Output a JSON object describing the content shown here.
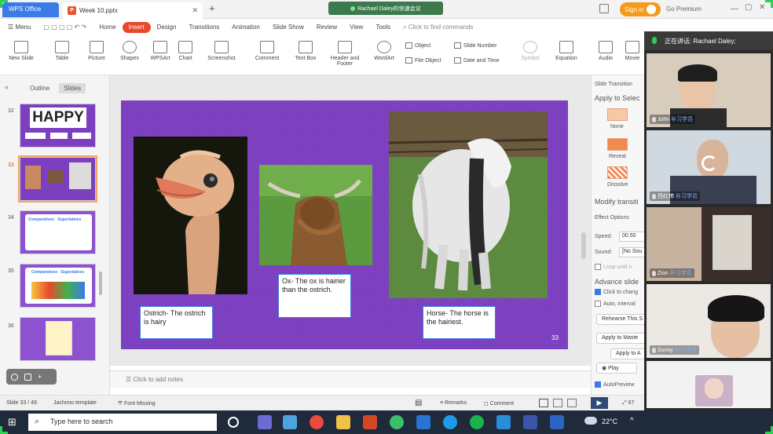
{
  "titlebar": {
    "app_tab": "WPS Office",
    "doc_tab": "Week 10.pptx",
    "meeting_label": "Rachael Daley的快速会议",
    "signin": "Sign in",
    "premium": "Go Premium"
  },
  "menu": {
    "menu_label": "Menu",
    "items": [
      "Home",
      "Insert",
      "Design",
      "Transitions",
      "Animation",
      "Slide Show",
      "Review",
      "View",
      "Tools"
    ],
    "active": "Insert",
    "search_placeholder": "Click to find commands"
  },
  "ribbon": {
    "big": [
      "New Slide",
      "Table",
      "Picture",
      "Shapes",
      "WPSArt",
      "Chart",
      "Screenshot",
      "Comment",
      "Text Box",
      "Header and Footer",
      "WordArt",
      "Symbol",
      "Equation",
      "Audio",
      "Movie"
    ],
    "small": [
      "Object",
      "File Object",
      "Slide Number",
      "Date and Time"
    ]
  },
  "left_panel": {
    "tabs": [
      "Outline",
      "Slides"
    ],
    "active_tab": "Slides",
    "slides": [
      {
        "num": "32",
        "title": "HAPPY"
      },
      {
        "num": "33",
        "title": ""
      },
      {
        "num": "34",
        "title": "Comparatives · Superlatives"
      },
      {
        "num": "35",
        "title": "Comparatives · Superlatives"
      },
      {
        "num": "36",
        "title": ""
      }
    ]
  },
  "slide": {
    "captions": [
      "Ostrich- The ostrich is hairy",
      "Ox- The ox is hairier than the ostrich.",
      "Horse- The horse is the hairiest."
    ],
    "page_number": "33"
  },
  "notes": {
    "placeholder": "Click to add notes"
  },
  "right_panel": {
    "title": "Slide Transition",
    "apply_to": "Apply to Selec",
    "transitions": [
      "None",
      "Reveal",
      "Dissolve"
    ],
    "modify": "Modify transiti",
    "effect_options": "Effect Options",
    "speed_label": "Speed:",
    "speed_value": "00.50",
    "sound_label": "Sound:",
    "sound_value": "[No Sou",
    "loop": "Loop until n",
    "advance": "Advance slide",
    "click_to_change": "Click to chang",
    "auto_interval": "Auto, interval",
    "rehearse": "Rehearse This S",
    "apply_master": "Apply to Maste",
    "apply_all": "Apply to A",
    "play": "Play",
    "autopreview": "AutoPreview"
  },
  "statusbar": {
    "slide_count": "Slide 33 / 49",
    "template": "Jachimo template",
    "font_missing": "Font Missing",
    "remarks": "Remarks",
    "comment": "Comment",
    "zoom": "67"
  },
  "taskbar": {
    "search_placeholder": "Type here to search",
    "temperature": "22°C"
  },
  "video": {
    "speaking": "正在讲话: Rachael Daley;",
    "participants": [
      {
        "name": "John",
        "tag": "补习学员"
      },
      {
        "name": "西红柿",
        "tag": "补习学员"
      },
      {
        "name": "Zion",
        "tag": "补习学员"
      },
      {
        "name": "Sunny",
        "tag": "补习学员"
      },
      {
        "name": "",
        "tag": ""
      }
    ]
  }
}
